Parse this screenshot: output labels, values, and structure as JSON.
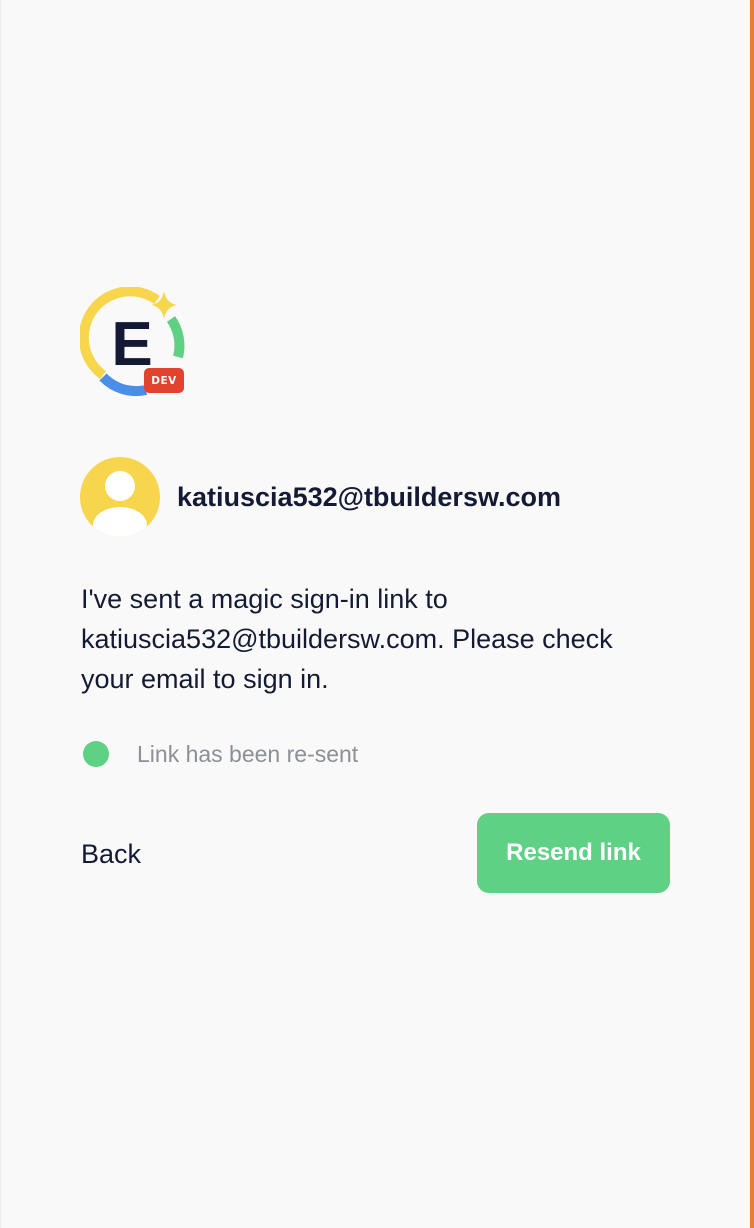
{
  "logo": {
    "letter": "E",
    "badge": "DEV"
  },
  "user": {
    "email": "katiuscia532@tbuildersw.com"
  },
  "message": {
    "text": "I've sent a magic sign-in link to katiuscia532@tbuildersw.com. Please check your email to sign in."
  },
  "status": {
    "text": "Link has been re-sent",
    "color": "#5ed184"
  },
  "actions": {
    "back_label": "Back",
    "resend_label": "Resend link"
  },
  "colors": {
    "accent_green": "#5ed184",
    "logo_yellow": "#f7d64d",
    "logo_blue": "#4a8ee8",
    "badge_red": "#e2432f",
    "text_dark": "#141a33",
    "right_edge": "#e47d35"
  }
}
